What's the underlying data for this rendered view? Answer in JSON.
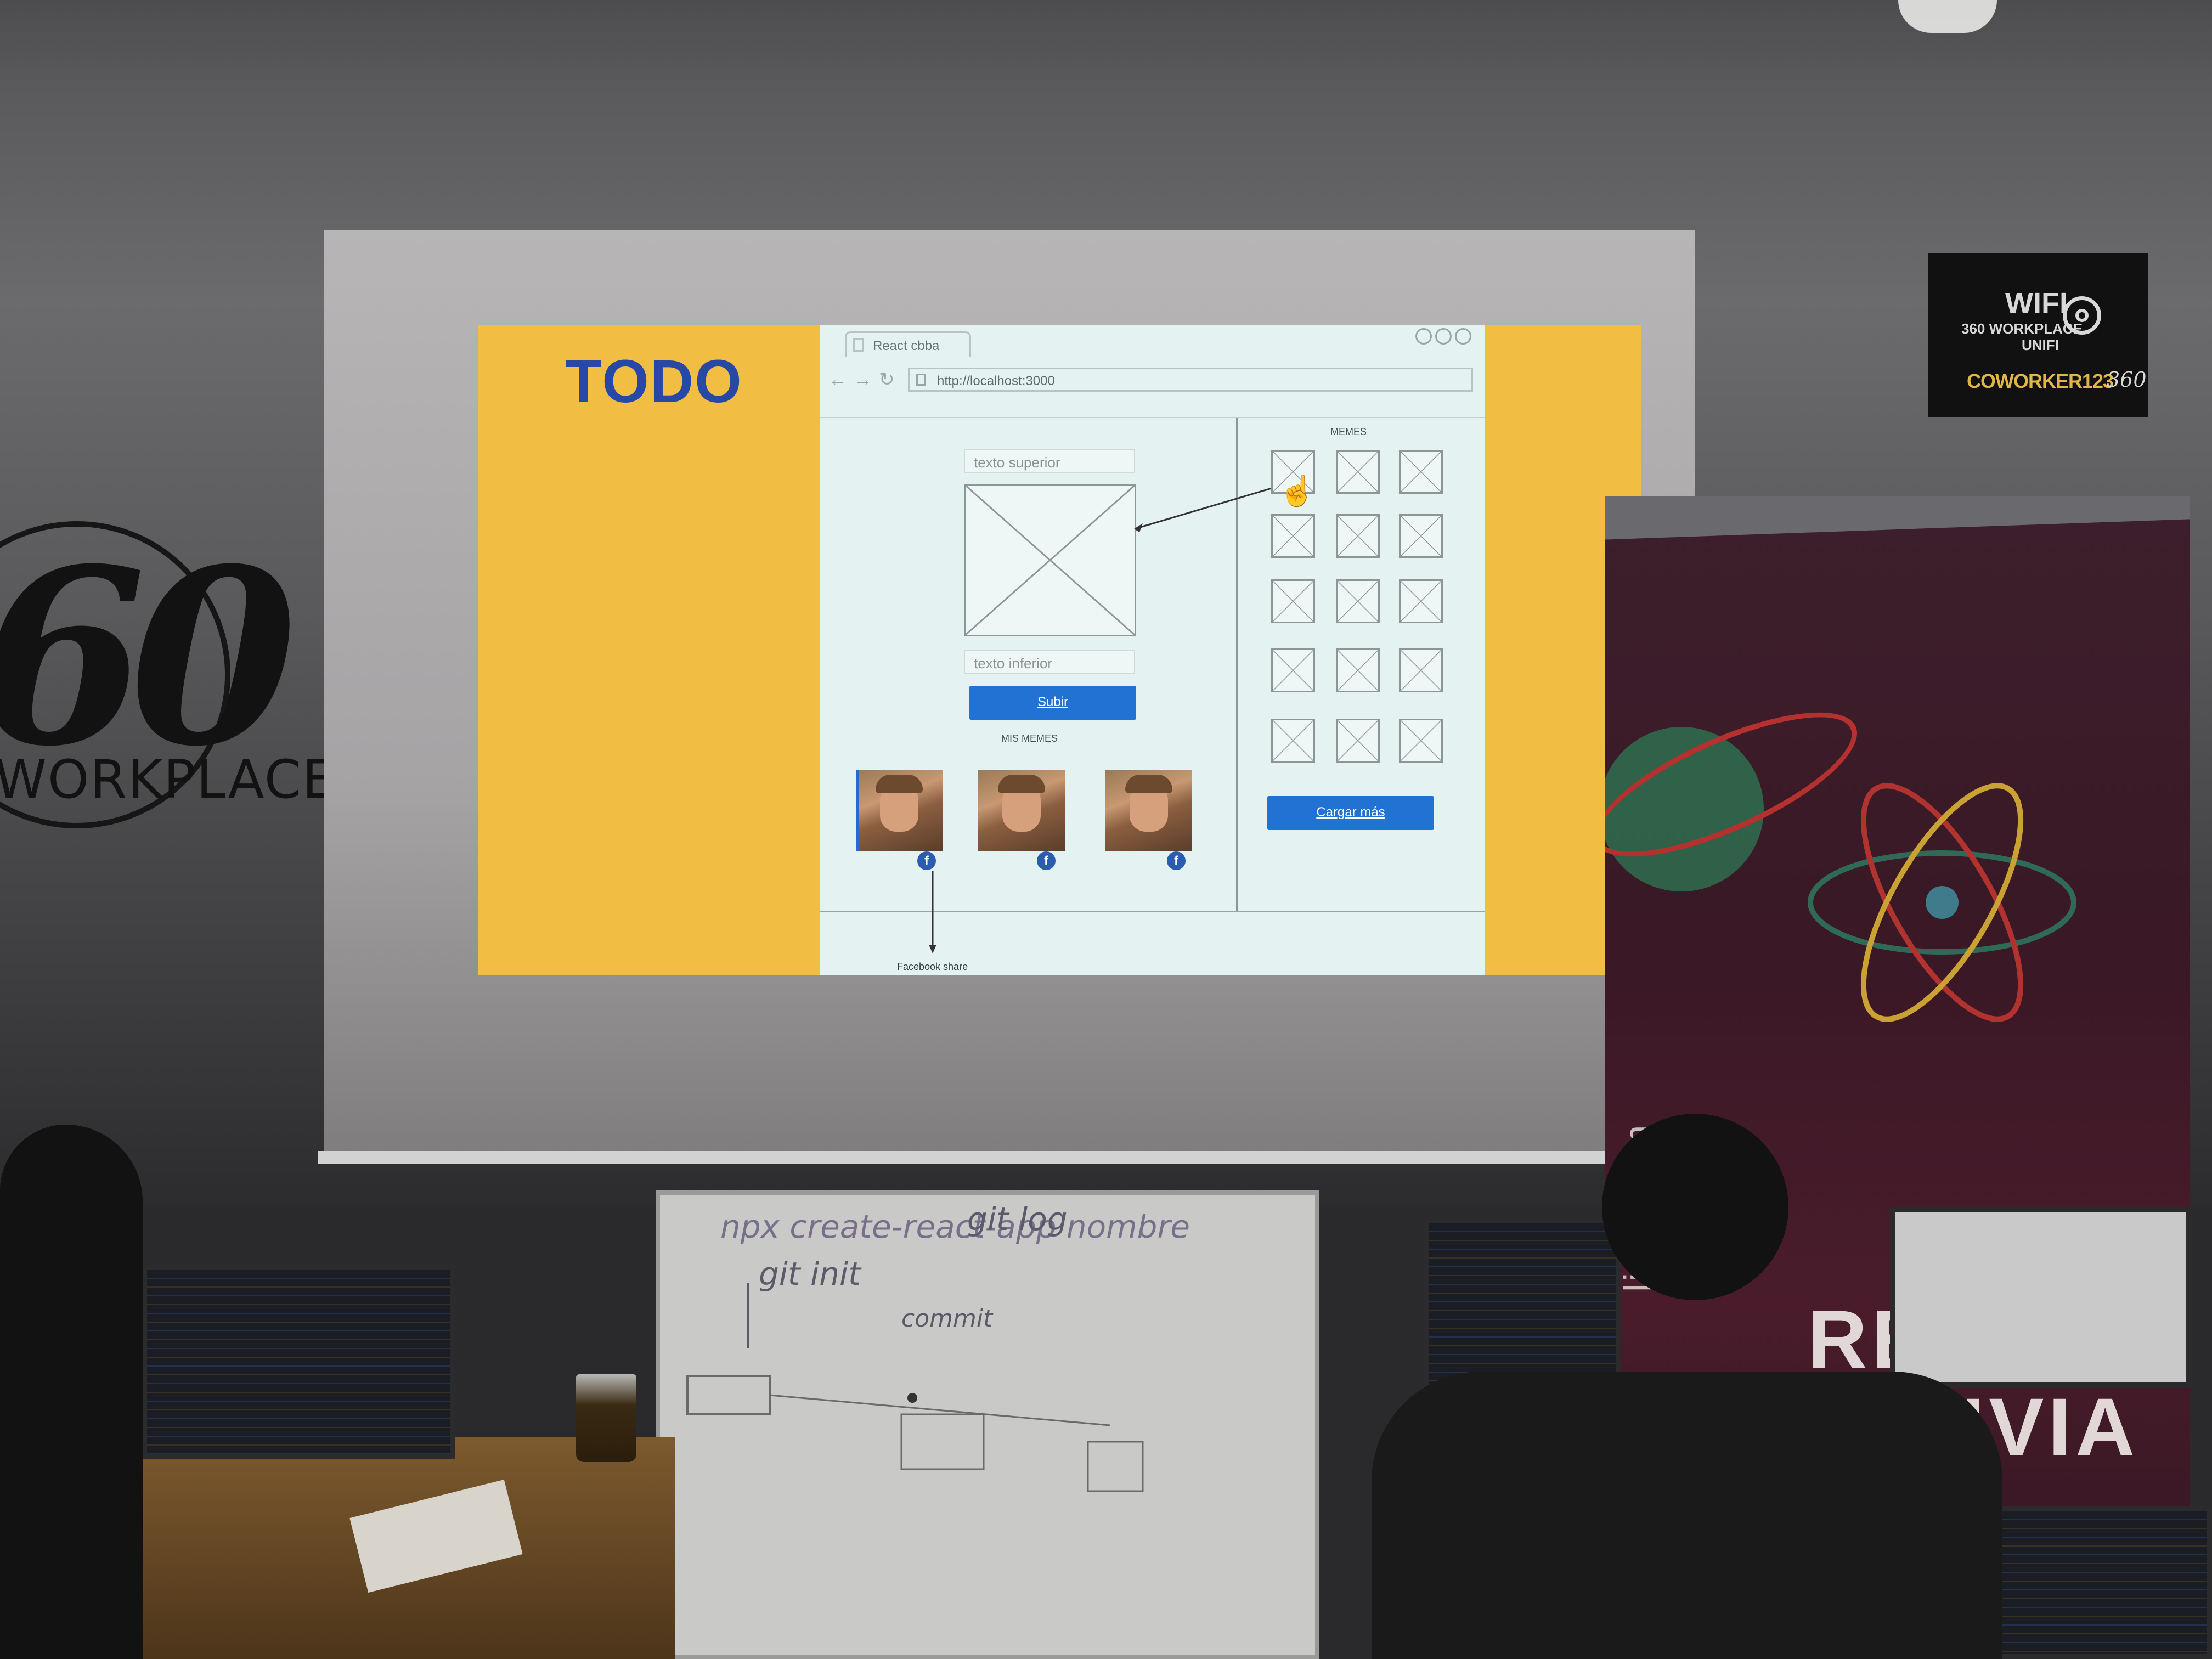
{
  "projection": {
    "slide_title": "TODO",
    "browser": {
      "tab_title": "React cbba",
      "url": "http://localhost:3000"
    },
    "editor": {
      "top_text_placeholder": "texto superior",
      "bottom_text_placeholder": "texto inferior",
      "upload_button": "Subir",
      "my_memes_heading": "MIS MEMES",
      "share_note": "Facebook share"
    },
    "gallery": {
      "heading": "MEMES",
      "load_more_button": "Cargar más"
    }
  },
  "wall": {
    "logo_number": "60",
    "logo_text": "WORKPLACE"
  },
  "wifi_sign": {
    "title": "WIFI",
    "line1": "360 WORKPLACE",
    "line2": "UNIFI",
    "brand": "COWORKER123",
    "mark": "360"
  },
  "banner": {
    "line1": "REACT",
    "line2": "BOLIVIA",
    "url": "livia.com"
  },
  "whiteboard": {
    "line1": "npx create-react-app nombre",
    "line2": "git log",
    "line3": "git init",
    "line4": "commit"
  },
  "colors": {
    "slide_background": "#f1bd43",
    "todo_text": "#2848a8",
    "button_blue": "#2272d4",
    "mockup_background": "#e4f2f1",
    "banner_background": "#3a1826"
  }
}
